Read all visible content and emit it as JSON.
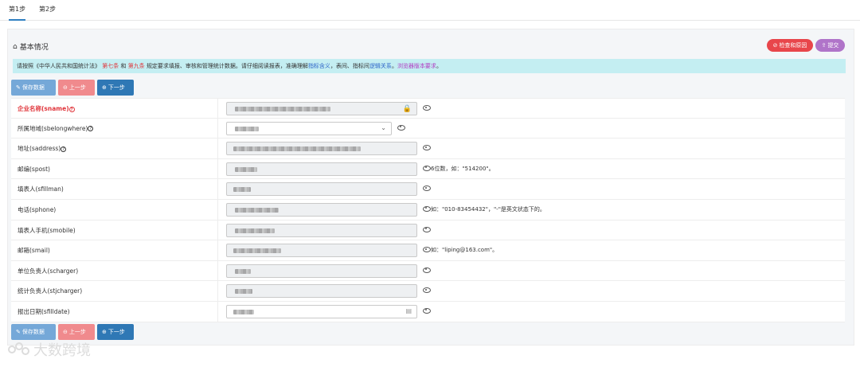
{
  "tabs": [
    {
      "label": "第1步",
      "active": true
    },
    {
      "label": "第2步",
      "active": false
    }
  ],
  "panel": {
    "title": "基本情况",
    "check_button": "检查和原因",
    "submit_button": "提交"
  },
  "notice": {
    "part1": "请按照《中华人民共和国统计法》",
    "law7": "第七条",
    "and": "和",
    "law9": "第九条",
    "part2": "规定要求填报、审核和管理统计数据。请仔细阅读报表，准确理解",
    "link1": "指标含义",
    "part3": "，表间、指标间",
    "link2": "逻辑关系",
    "part4": "。",
    "link3": "浏览器版本要求",
    "part5": "。"
  },
  "toolbar": {
    "save": "保存数据",
    "prev": "上一步",
    "next": "下一步"
  },
  "fields": [
    {
      "label": "企业名称(sname)",
      "required": true,
      "help": true
    },
    {
      "label": "所属地域(sbelongwhere)",
      "required": false,
      "help": true
    },
    {
      "label": "地址(saddress)",
      "required": false,
      "help": true
    },
    {
      "label": "邮编(spost)",
      "required": false,
      "help": false,
      "hint": "6位数，如：\"514200\"。"
    },
    {
      "label": "填表人(sfillman)",
      "required": false,
      "help": false
    },
    {
      "label": "电话(sphone)",
      "required": false,
      "help": false,
      "hint": "如：\"010-83454432\"，\"-\"是英文状态下的。"
    },
    {
      "label": "填表人手机(smobile)",
      "required": false,
      "help": false
    },
    {
      "label": "邮箱(smail)",
      "required": false,
      "help": false,
      "hint": "如：\"liping@163.com\"。"
    },
    {
      "label": "单位负责人(scharger)",
      "required": false,
      "help": false
    },
    {
      "label": "统计负责人(stjcharger)",
      "required": false,
      "help": false
    },
    {
      "label": "报出日期(sfilldate)",
      "required": false,
      "help": false
    }
  ],
  "icons": {
    "home": "home-icon",
    "lock": "lock-icon",
    "eye": "eye-icon",
    "chevron": "chevron-down-icon",
    "calendar": "calendar-icon"
  },
  "colors": {
    "accent": "#2f78b5",
    "danger": "#e8464b",
    "purple": "#b074c9",
    "notice_bg": "#c4eef2"
  },
  "watermark": "大数跨境"
}
